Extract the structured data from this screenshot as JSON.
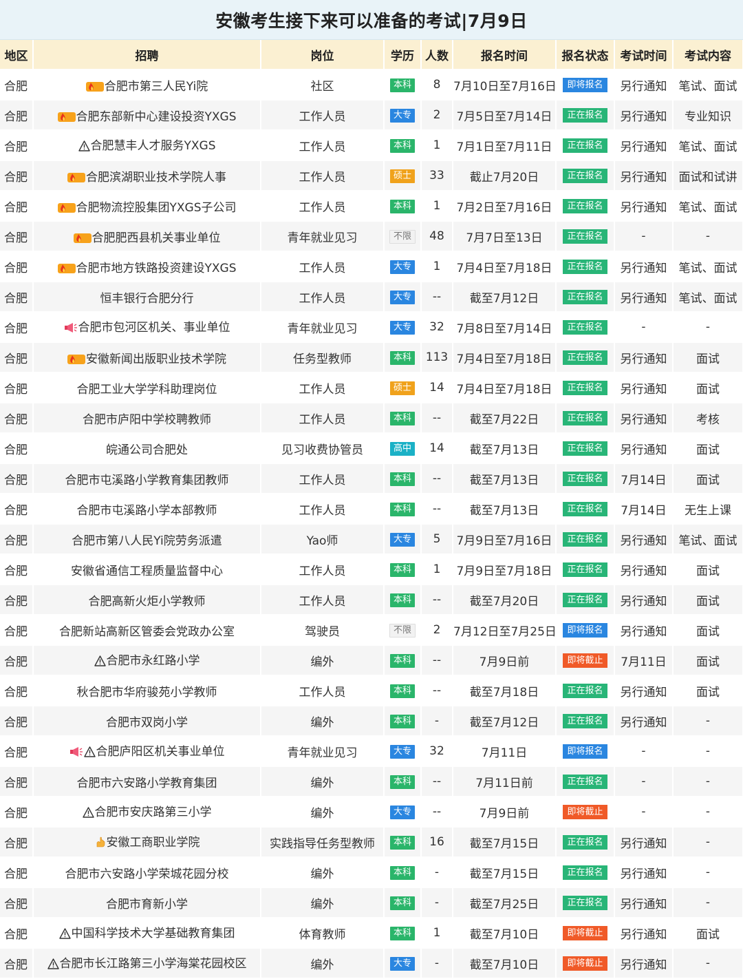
{
  "title": "安徽考生接下来可以准备的考试|7月9日",
  "headers": [
    "地区",
    "招聘",
    "岗位",
    "学历",
    "人数",
    "报名时间",
    "报名状态",
    "考试时间",
    "考试内容"
  ],
  "rows": [
    {
      "region": "合肥",
      "icon": "fire-icon",
      "org": "合肥市第三人民Yi院",
      "post": "社区",
      "edu": "本科",
      "count": "8",
      "time": "7月10日至7月16日",
      "status": "即将报名",
      "exam_time": "另行通知",
      "content": "笔试、面试"
    },
    {
      "region": "合肥",
      "icon": "fire-icon",
      "org": "合肥东部新中心建设投资YXGS",
      "post": "工作人员",
      "edu": "大专",
      "count": "2",
      "time": "7月5日至7月14日",
      "status": "正在报名",
      "exam_time": "另行通知",
      "content": "专业知识"
    },
    {
      "region": "合肥",
      "icon": "warning-icon",
      "org": "合肥慧丰人才服务YXGS",
      "post": "工作人员",
      "edu": "本科",
      "count": "1",
      "time": "7月1日至7月11日",
      "status": "正在报名",
      "exam_time": "另行通知",
      "content": "笔试、面试"
    },
    {
      "region": "合肥",
      "icon": "fire-icon",
      "org": "合肥滨湖职业技术学院人事",
      "post": "工作人员",
      "edu": "硕士",
      "count": "33",
      "time": "截止7月20日",
      "status": "正在报名",
      "exam_time": "另行通知",
      "content": "面试和试讲"
    },
    {
      "region": "合肥",
      "icon": "fire-icon",
      "org": "合肥物流控股集团YXGS子公司",
      "post": "工作人员",
      "edu": "本科",
      "count": "1",
      "time": "7月2日至7月16日",
      "status": "正在报名",
      "exam_time": "另行通知",
      "content": "笔试、面试"
    },
    {
      "region": "合肥",
      "icon": "fire-icon",
      "org": "合肥肥西县机关事业单位",
      "post": "青年就业见习",
      "edu": "不限",
      "count": "48",
      "time": "7月7日至13日",
      "status": "正在报名",
      "exam_time": "-",
      "content": "-"
    },
    {
      "region": "合肥",
      "icon": "fire-icon",
      "org": "合肥市地方铁路投资建设YXGS",
      "post": "工作人员",
      "edu": "大专",
      "count": "1",
      "time": "7月4日至7月18日",
      "status": "正在报名",
      "exam_time": "另行通知",
      "content": "笔试、面试"
    },
    {
      "region": "合肥",
      "icon": "",
      "org": "恒丰银行合肥分行",
      "post": "工作人员",
      "edu": "大专",
      "count": "--",
      "time": "截至7月12日",
      "status": "正在报名",
      "exam_time": "另行通知",
      "content": "笔试、面试"
    },
    {
      "region": "合肥",
      "icon": "megaphone-icon",
      "org": "合肥市包河区机关、事业单位",
      "post": "青年就业见习",
      "edu": "大专",
      "count": "32",
      "time": "7月8日至7月14日",
      "status": "正在报名",
      "exam_time": "-",
      "content": "-"
    },
    {
      "region": "合肥",
      "icon": "fire-icon",
      "org": "安徽新闻出版职业技术学院",
      "post": "任务型教师",
      "edu": "本科",
      "count": "113",
      "time": "7月4日至7月18日",
      "status": "正在报名",
      "exam_time": "另行通知",
      "content": "面试"
    },
    {
      "region": "合肥",
      "icon": "",
      "org": "合肥工业大学学科助理岗位",
      "post": "工作人员",
      "edu": "硕士",
      "count": "14",
      "time": "7月4日至7月18日",
      "status": "正在报名",
      "exam_time": "另行通知",
      "content": "面试"
    },
    {
      "region": "合肥",
      "icon": "",
      "org": "合肥市庐阳中学校聘教师",
      "post": "工作人员",
      "edu": "本科",
      "count": "--",
      "time": "截至7月22日",
      "status": "正在报名",
      "exam_time": "另行通知",
      "content": "考核"
    },
    {
      "region": "合肥",
      "icon": "",
      "org": "皖通公司合肥处",
      "post": "见习收费协管员",
      "edu": "高中",
      "count": "14",
      "time": "截至7月13日",
      "status": "正在报名",
      "exam_time": "另行通知",
      "content": "面试"
    },
    {
      "region": "合肥",
      "icon": "",
      "org": "合肥市屯溪路小学教育集团教师",
      "post": "工作人员",
      "edu": "本科",
      "count": "--",
      "time": "截至7月13日",
      "status": "正在报名",
      "exam_time": "7月14日",
      "content": "面试"
    },
    {
      "region": "合肥",
      "icon": "",
      "org": "合肥市屯溪路小学本部教师",
      "post": "工作人员",
      "edu": "本科",
      "count": "--",
      "time": "截至7月13日",
      "status": "正在报名",
      "exam_time": "7月14日",
      "content": "无生上课"
    },
    {
      "region": "合肥",
      "icon": "",
      "org": "合肥市第八人民Yi院劳务派遣",
      "post": "Yao师",
      "edu": "大专",
      "count": "5",
      "time": "7月9日至7月16日",
      "status": "正在报名",
      "exam_time": "另行通知",
      "content": "笔试、面试"
    },
    {
      "region": "合肥",
      "icon": "",
      "org": "安徽省通信工程质量监督中心",
      "post": "工作人员",
      "edu": "本科",
      "count": "1",
      "time": "7月9日至7月18日",
      "status": "正在报名",
      "exam_time": "另行通知",
      "content": "面试"
    },
    {
      "region": "合肥",
      "icon": "",
      "org": "合肥高新火炬小学教师",
      "post": "工作人员",
      "edu": "本科",
      "count": "--",
      "time": "截至7月20日",
      "status": "正在报名",
      "exam_time": "另行通知",
      "content": "面试"
    },
    {
      "region": "合肥",
      "icon": "",
      "org": "合肥新站高新区管委会党政办公室",
      "post": "驾驶员",
      "edu": "不限",
      "count": "2",
      "time": "7月12日至7月25日",
      "status": "即将报名",
      "exam_time": "另行通知",
      "content": "面试"
    },
    {
      "region": "合肥",
      "icon": "warning-icon",
      "org": "合肥市永红路小学",
      "post": "编外",
      "edu": "本科",
      "count": "--",
      "time": "7月9日前",
      "status": "即将截止",
      "exam_time": "7月11日",
      "content": "面试"
    },
    {
      "region": "合肥",
      "icon": "",
      "org": "秋合肥市华府骏苑小学教师",
      "post": "工作人员",
      "edu": "本科",
      "count": "--",
      "time": "截至7月18日",
      "status": "正在报名",
      "exam_time": "另行通知",
      "content": "面试"
    },
    {
      "region": "合肥",
      "icon": "",
      "org": "合肥市双岗小学",
      "post": "编外",
      "edu": "本科",
      "count": "-",
      "time": "截至7月12日",
      "status": "正在报名",
      "exam_time": "另行通知",
      "content": "-"
    },
    {
      "region": "合肥",
      "icon": "megaphone-warning-icon",
      "org": "合肥庐阳区机关事业单位",
      "post": "青年就业见习",
      "edu": "大专",
      "count": "32",
      "time": "7月11日",
      "status": "即将报名",
      "exam_time": "-",
      "content": "-"
    },
    {
      "region": "合肥",
      "icon": "",
      "org": "合肥市六安路小学教育集团",
      "post": "编外",
      "edu": "本科",
      "count": "--",
      "time": "7月11日前",
      "status": "正在报名",
      "exam_time": "-",
      "content": "-"
    },
    {
      "region": "合肥",
      "icon": "warning-icon",
      "org": "合肥市安庆路第三小学",
      "post": "编外",
      "edu": "大专",
      "count": "--",
      "time": "7月9日前",
      "status": "即将截止",
      "exam_time": "-",
      "content": "-"
    },
    {
      "region": "合肥",
      "icon": "hand-icon",
      "org": "安徽工商职业学院",
      "post": "实践指导任务型教师",
      "edu": "本科",
      "count": "16",
      "time": "截至7月15日",
      "status": "正在报名",
      "exam_time": "另行通知",
      "content": "-"
    },
    {
      "region": "合肥",
      "icon": "",
      "org": "合肥市六安路小学荣城花园分校",
      "post": "编外",
      "edu": "本科",
      "count": "-",
      "time": "截至7月15日",
      "status": "正在报名",
      "exam_time": "另行通知",
      "content": "-"
    },
    {
      "region": "合肥",
      "icon": "",
      "org": "合肥市育新小学",
      "post": "编外",
      "edu": "本科",
      "count": "-",
      "time": "截至7月25日",
      "status": "正在报名",
      "exam_time": "另行通知",
      "content": "-"
    },
    {
      "region": "合肥",
      "icon": "warning-icon",
      "org": "中国科学技术大学基础教育集团",
      "post": "体育教师",
      "edu": "本科",
      "count": "1",
      "time": "截至7月10日",
      "status": "即将截止",
      "exam_time": "另行通知",
      "content": "面试"
    },
    {
      "region": "合肥",
      "icon": "warning-icon",
      "org": "合肥市长江路第三小学海棠花园校区",
      "post": "编外",
      "edu": "大专",
      "count": "-",
      "time": "截至7月10日",
      "status": "即将截止",
      "exam_time": "另行通知",
      "content": "-"
    }
  ]
}
